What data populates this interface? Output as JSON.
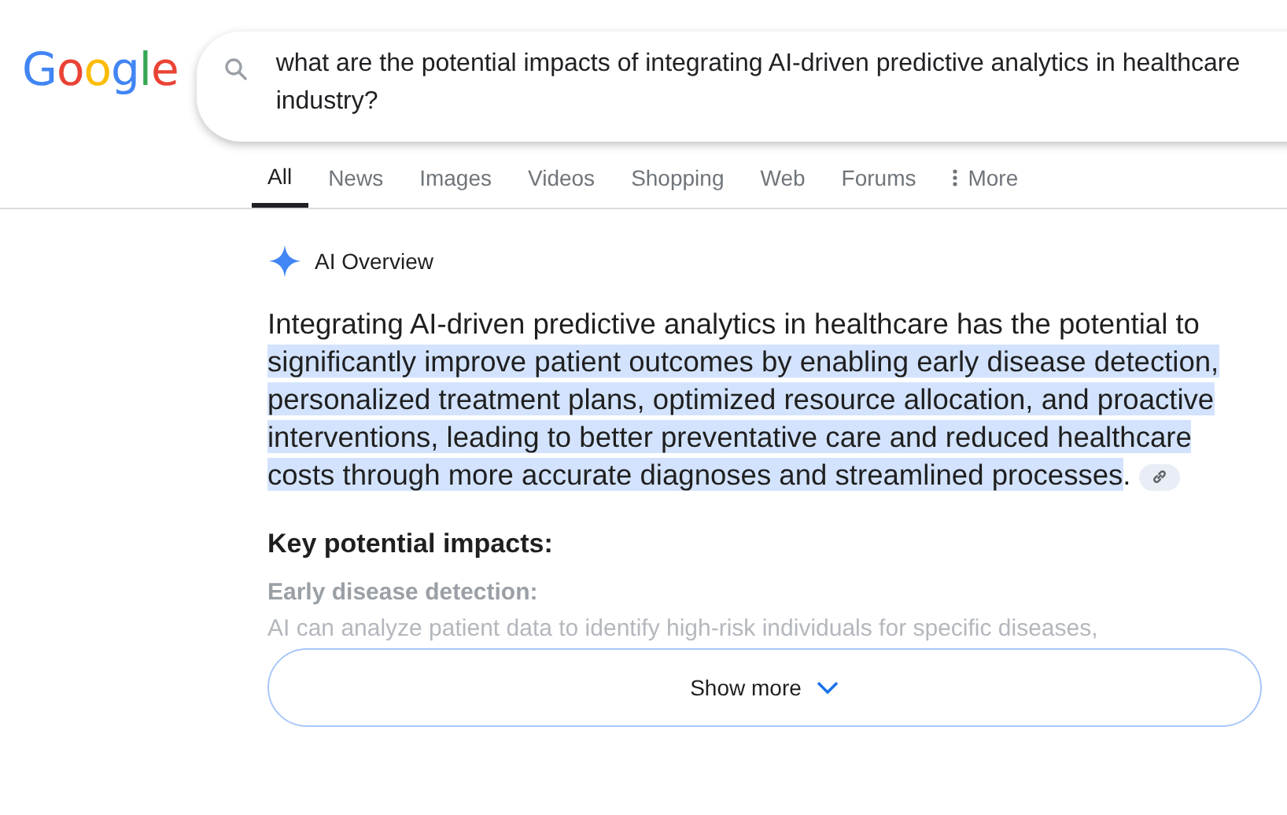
{
  "logo": {
    "text": "Google"
  },
  "search": {
    "value": "what are the potential impacts of integrating AI-driven predictive analytics in healthcare industry?"
  },
  "tabs": [
    {
      "label": "All",
      "selected": true
    },
    {
      "label": "News",
      "selected": false
    },
    {
      "label": "Images",
      "selected": false
    },
    {
      "label": "Videos",
      "selected": false
    },
    {
      "label": "Shopping",
      "selected": false
    },
    {
      "label": "Web",
      "selected": false
    },
    {
      "label": "Forums",
      "selected": false
    },
    {
      "label": "More",
      "selected": false,
      "kind": "menu"
    }
  ],
  "overview": {
    "title": "AI Overview",
    "intro": "Integrating AI-driven predictive analytics in healthcare has the potential to",
    "highlight": "significantly improve patient outcomes by enabling early disease detection, personalized treatment plans, optimized resource allocation, and proactive interventions, leading to better preventative care and reduced healthcare costs through more accurate diagnoses and streamlined processes",
    "ending": ".",
    "heading": "Key potential impacts:",
    "subheading": "Early disease detection:",
    "faded_text": "AI can analyze patient data to identify high-risk individuals for specific diseases,"
  },
  "show_more": {
    "label": "Show more"
  }
}
